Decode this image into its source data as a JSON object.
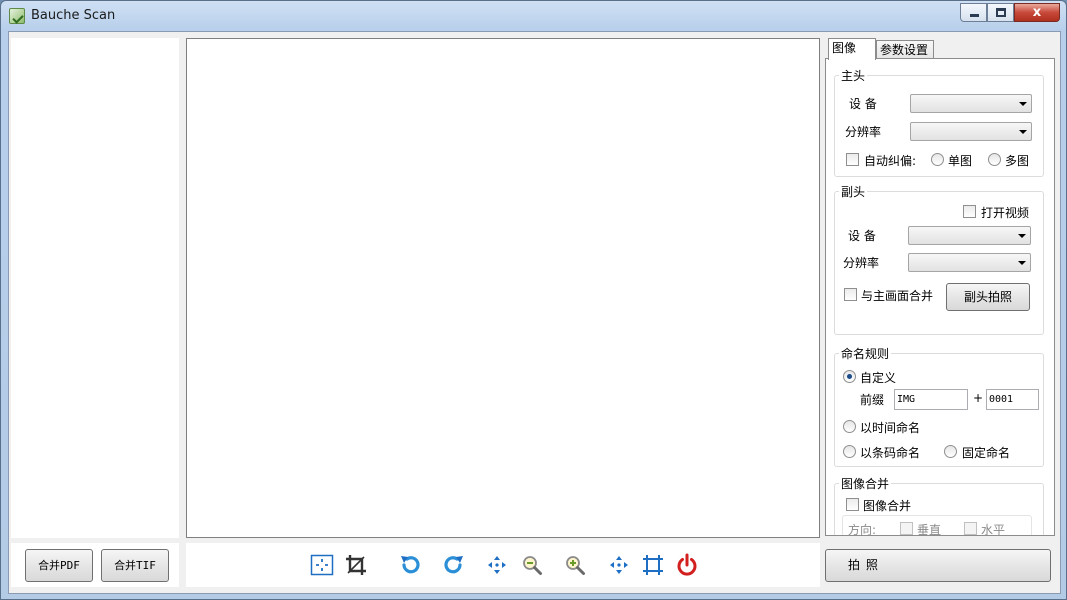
{
  "window": {
    "title": "Bauche Scan",
    "controls": {
      "close": "x"
    }
  },
  "merge_buttons": {
    "pdf": "合并PDF",
    "tif": "合并TIF"
  },
  "toolbar": [
    {
      "name": "select-area-icon"
    },
    {
      "name": "crop-icon"
    },
    {
      "name": "rotate-left-icon"
    },
    {
      "name": "rotate-right-icon"
    },
    {
      "name": "move-icon"
    },
    {
      "name": "zoom-out-icon"
    },
    {
      "name": "zoom-in-icon"
    },
    {
      "name": "fit-icon"
    },
    {
      "name": "actual-size-icon"
    },
    {
      "name": "power-icon"
    }
  ],
  "tabs": [
    {
      "label": "图像",
      "active": true
    },
    {
      "label": "参数设置",
      "active": false
    }
  ],
  "main_camera": {
    "title": "主头",
    "device_label": "设 备",
    "resolution_label": "分辨率",
    "auto_deskew_label": "自动纠偏:",
    "single_label": "单图",
    "multi_label": "多图"
  },
  "sub_camera": {
    "title": "副头",
    "open_video_label": "打开视频",
    "device_label": "设 备",
    "resolution_label": "分辨率",
    "merge_with_main_label": "与主画面合并",
    "capture_button": "副头拍照"
  },
  "naming": {
    "title": "命名规则",
    "custom_label": "自定义",
    "prefix_label": "前缀",
    "prefix_value": "IMG",
    "plus": "+",
    "counter_value": "0001",
    "by_time_label": "以时间命名",
    "by_barcode_label": "以条码命名",
    "fixed_label": "固定命名"
  },
  "image_merge": {
    "title": "图像合并",
    "merge_label": "图像合并",
    "direction_label": "方向:",
    "vertical_label": "垂直",
    "horizontal_label": "水平"
  },
  "shoot_button": "拍 照",
  "colors": {
    "accent_blue": "#1e6fc4",
    "power_red": "#d21f1f"
  }
}
